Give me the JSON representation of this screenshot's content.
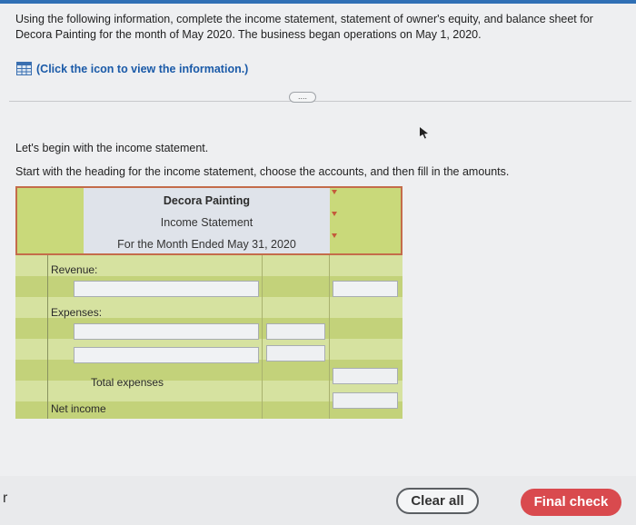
{
  "instructions": "Using the following information, complete the income statement, statement of owner's equity, and balance sheet for Decora Painting for the month of May 2020. The business began operations on May 1, 2020.",
  "info_link": "(Click the icon to view the information.)",
  "more_button": "....",
  "lead_text": "Let's begin with the income statement.",
  "sub_text": "Start with the heading for the income statement, choose the accounts, and then fill in the amounts.",
  "statement": {
    "company": "Decora Painting",
    "name": "Income Statement",
    "period": "For the Month Ended May 31, 2020",
    "revenue_label": "Revenue:",
    "expenses_label": "Expenses:",
    "total_expenses_label": "Total expenses",
    "net_income_label": "Net income"
  },
  "side_glyph": "r",
  "buttons": {
    "clear_all": "Clear all",
    "final_check": "Final check"
  },
  "colors": {
    "accent": "#2f6fb5",
    "final_check": "#d94a4e",
    "header_border": "#c46c4a",
    "table_green": "#c9d97a"
  },
  "icons": {
    "info": "table-grid-icon",
    "cursor": "mouse-pointer-icon"
  }
}
